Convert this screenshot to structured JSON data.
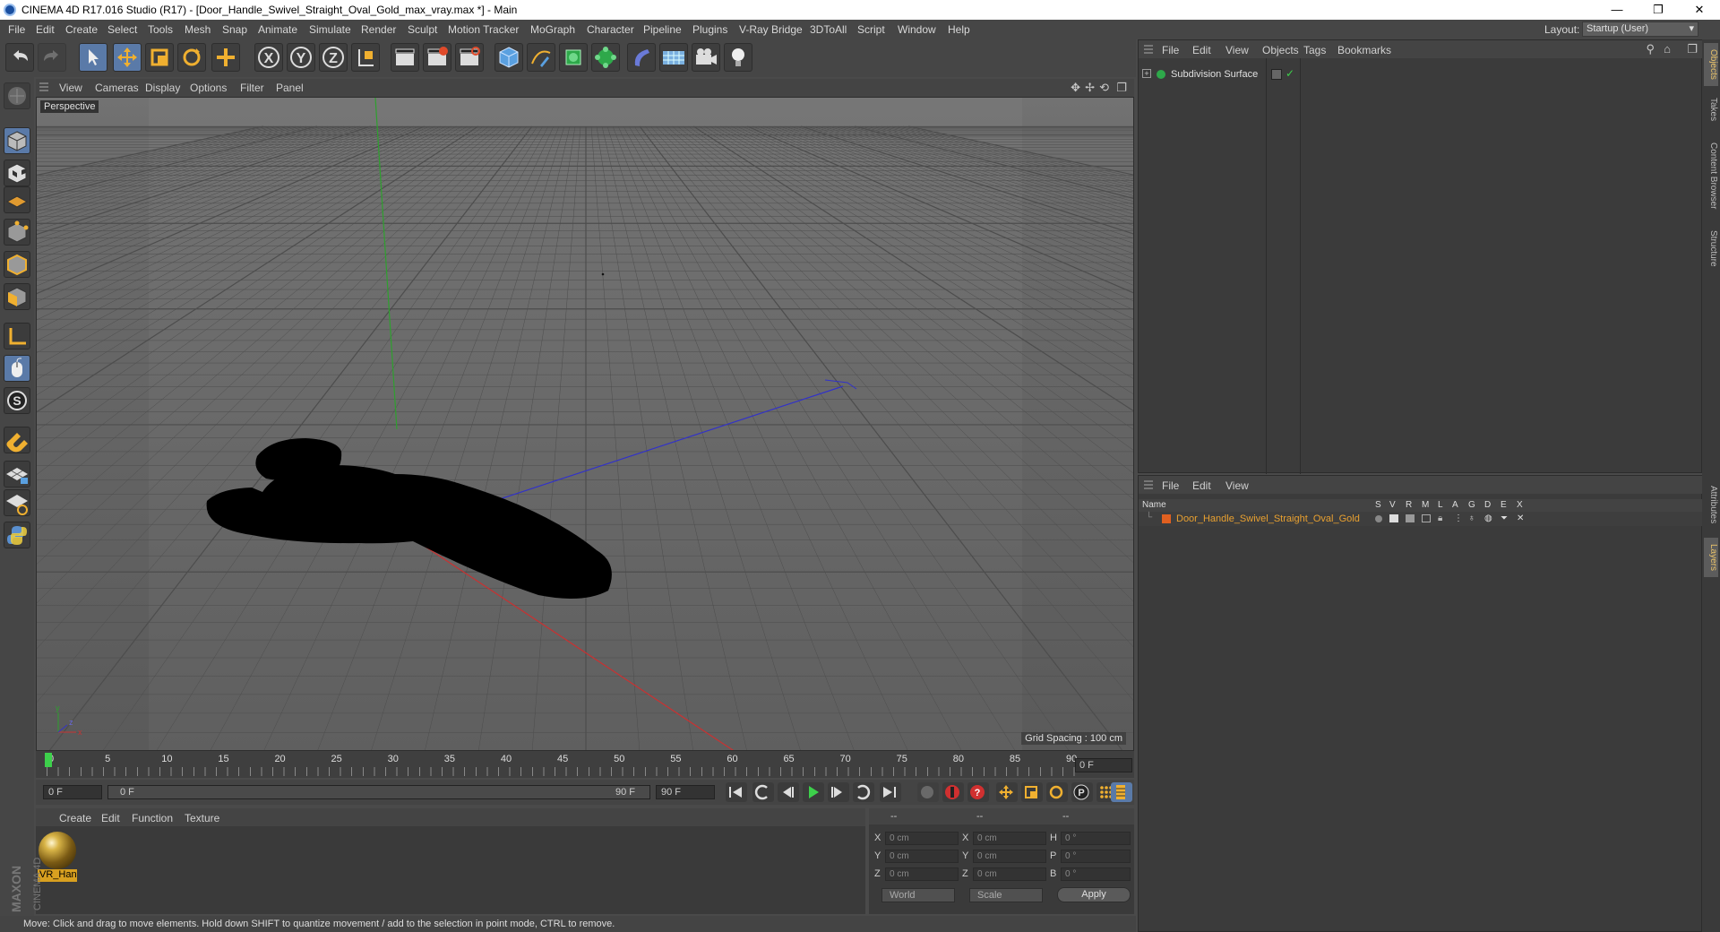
{
  "window": {
    "title": "CINEMA 4D R17.016 Studio (R17) - [Door_Handle_Swivel_Straight_Oval_Gold_max_vray.max *] - Main",
    "controls": [
      "—",
      "❐",
      "✕"
    ]
  },
  "menu": [
    "File",
    "Edit",
    "Create",
    "Select",
    "Tools",
    "Mesh",
    "Snap",
    "Animate",
    "Simulate",
    "Render",
    "Sculpt",
    "Motion Tracker",
    "MoGraph",
    "Character",
    "Pipeline",
    "Plugins",
    "V-Ray Bridge",
    "3DToAll",
    "Script",
    "Window",
    "Help"
  ],
  "layout": {
    "label": "Layout:",
    "value": "Startup (User)"
  },
  "viewport": {
    "menu": [
      "View",
      "Cameras",
      "Display",
      "Options",
      "Filter",
      "Panel"
    ],
    "label": "Perspective",
    "grid_spacing": "Grid Spacing : 100 cm"
  },
  "timeline": {
    "ticks": [
      "0",
      "5",
      "10",
      "15",
      "20",
      "25",
      "30",
      "35",
      "40",
      "45",
      "50",
      "55",
      "60",
      "65",
      "70",
      "75",
      "80",
      "85",
      "90"
    ],
    "current_frame": "0 F"
  },
  "playback": {
    "start": "0 F",
    "range_start": "0 F",
    "range_end": "90 F",
    "end": "90 F"
  },
  "material_manager": {
    "menu": [
      "Create",
      "Edit",
      "Function",
      "Texture"
    ],
    "material_name": "VR_Han"
  },
  "coordinates": {
    "header": [
      "--",
      "--",
      "--"
    ],
    "rows": [
      {
        "a": "X",
        "v1": "0 cm",
        "b": "X",
        "v2": "0 cm",
        "c": "H",
        "v3": "0 °"
      },
      {
        "a": "Y",
        "v1": "0 cm",
        "b": "Y",
        "v2": "0 cm",
        "c": "P",
        "v3": "0 °"
      },
      {
        "a": "Z",
        "v1": "0 cm",
        "b": "Z",
        "v2": "0 cm",
        "c": "B",
        "v3": "0 °"
      }
    ],
    "mode": "World",
    "size_mode": "Scale",
    "apply": "Apply"
  },
  "status": "Move: Click and drag to move elements. Hold down SHIFT to quantize movement / add to the selection in point mode, CTRL to remove.",
  "object_manager": {
    "menu": [
      "File",
      "Edit",
      "View",
      "Objects",
      "Tags",
      "Bookmarks"
    ],
    "object_name": "Subdivision Surface"
  },
  "layer_manager": {
    "menu": [
      "File",
      "Edit",
      "View"
    ],
    "columns": [
      "Name",
      "S",
      "V",
      "R",
      "M",
      "L",
      "A",
      "G",
      "D",
      "E",
      "X"
    ],
    "layer_name": "Door_Handle_Swivel_Straight_Oval_Gold"
  },
  "side_tabs": [
    "Objects",
    "Takes",
    "Content Browser",
    "Structure",
    "Attributes",
    "Layers"
  ],
  "brand": {
    "line1": "MAXON",
    "line2": "CINEMA 4D"
  },
  "colors": {
    "accent": "#e8a030",
    "axis_x": "#c83232",
    "axis_y": "#2ea02e",
    "axis_z": "#3232c8",
    "highlight": "#5a7aa8"
  }
}
